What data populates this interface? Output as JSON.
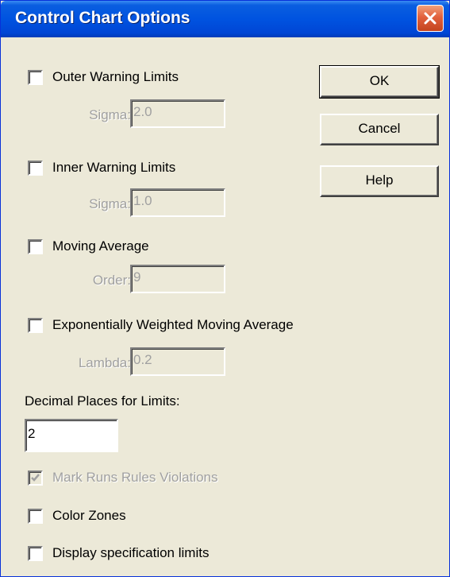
{
  "window": {
    "title": "Control Chart Options"
  },
  "options": {
    "outer_warning": {
      "label": "Outer Warning Limits",
      "checked": false,
      "param_label": "Sigma:",
      "param_value": "2.0"
    },
    "inner_warning": {
      "label": "Inner Warning Limits",
      "checked": false,
      "param_label": "Sigma:",
      "param_value": "1.0"
    },
    "moving_average": {
      "label": "Moving Average",
      "checked": false,
      "param_label": "Order:",
      "param_value": "9"
    },
    "ewma": {
      "label": "Exponentially Weighted Moving Average",
      "checked": false,
      "param_label": "Lambda:",
      "param_value": "0.2"
    }
  },
  "decimal_places": {
    "label": "Decimal Places for Limits:",
    "value": "2"
  },
  "mark_runs": {
    "label": "Mark Runs Rules Violations",
    "checked": true,
    "enabled": false
  },
  "color_zones": {
    "label": "Color Zones",
    "checked": false
  },
  "display_spec_limits": {
    "label": "Display specification limits",
    "checked": false
  },
  "buttons": {
    "ok": "OK",
    "cancel": "Cancel",
    "help": "Help"
  },
  "colors": {
    "dialog_face": "#ece9d8",
    "titlebar_blue": "#0053e0",
    "close_red": "#e2613d",
    "disabled_text": "#a0a0a0"
  },
  "icons": {
    "close": "close-icon",
    "check": "check-icon"
  }
}
